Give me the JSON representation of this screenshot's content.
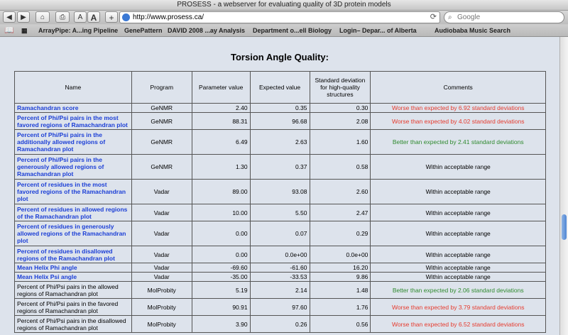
{
  "window": {
    "title": "PROSESS - a webserver for evaluating quality of 3D protein models"
  },
  "toolbar": {
    "back": "◀",
    "forward": "▶",
    "home": "⌂",
    "print": "⎙",
    "text_small": "A",
    "text_large": "A",
    "add_bookmark": "+",
    "url": "http://www.prosess.ca/",
    "reload": "⟳",
    "search_placeholder": "Google"
  },
  "bookmarks": [
    "ArrayPipe: A...ing Pipeline",
    "GenePattern",
    "DAVID 2008 ...ay Analysis",
    "Department o...ell Biology",
    "Login– Depar... of Alberta",
    "Audiobaba Music Search"
  ],
  "page": {
    "heading": "Torsion Angle Quality:",
    "columns": [
      "Name",
      "Program",
      "Parameter value",
      "Expected value",
      "Standard deviation for high-quality structures",
      "Comments"
    ],
    "rows": [
      {
        "name": "Ramachandran score",
        "link": true,
        "program": "GeNMR",
        "param": "2.40",
        "expected": "0.35",
        "sd": "0.30",
        "comment": "Worse than expected by 6.92 standard deviations",
        "status": "bad"
      },
      {
        "name": "Percent of Phi/Psi pairs in the most favored regions of Ramachandran plot",
        "link": true,
        "program": "GeNMR",
        "param": "88.31",
        "expected": "96.68",
        "sd": "2.08",
        "comment": "Worse than expected by 4.02 standard deviations",
        "status": "bad"
      },
      {
        "name": "Percent of Phi/Psi pairs in the additionally allowed regions of Ramachandran plot",
        "link": true,
        "program": "GeNMR",
        "param": "6.49",
        "expected": "2.63",
        "sd": "1.60",
        "comment": "Better than expected by 2.41 standard deviations",
        "status": "good"
      },
      {
        "name": "Percent of Phi/Psi pairs in the generously allowed regions of Ramachandran plot",
        "link": true,
        "program": "GeNMR",
        "param": "1.30",
        "expected": "0.37",
        "sd": "0.58",
        "comment": "Within acceptable range",
        "status": "ok"
      },
      {
        "name": "Percent of residues in the most favored regions of the Ramachandran plot",
        "link": true,
        "program": "Vadar",
        "param": "89.00",
        "expected": "93.08",
        "sd": "2.60",
        "comment": "Within acceptable range",
        "status": "ok"
      },
      {
        "name": "Percent of residues in allowed regions of the Ramachandran plot",
        "link": true,
        "program": "Vadar",
        "param": "10.00",
        "expected": "5.50",
        "sd": "2.47",
        "comment": "Within acceptable range",
        "status": "ok"
      },
      {
        "name": "Percent of residues in generously allowed regions of the Ramachandran plot",
        "link": true,
        "program": "Vadar",
        "param": "0.00",
        "expected": "0.07",
        "sd": "0.29",
        "comment": "Within acceptable range",
        "status": "ok"
      },
      {
        "name": "Percent of residues in disallowed regions of the Ramachandran plot",
        "link": true,
        "program": "Vadar",
        "param": "0.00",
        "expected": "0.0e+00",
        "sd": "0.0e+00",
        "comment": "Within acceptable range",
        "status": "ok"
      },
      {
        "name": "Mean Helix Phi angle",
        "link": true,
        "program": "Vadar",
        "param": "-69.60",
        "expected": "-61.60",
        "sd": "16.20",
        "comment": "Within acceptable range",
        "status": "ok"
      },
      {
        "name": "Mean Helix Psi angle",
        "link": true,
        "program": "Vadar",
        "param": "-35.00",
        "expected": "-33.53",
        "sd": "9.86",
        "comment": "Within acceptable range",
        "status": "ok"
      },
      {
        "name": "Percent of Phi/Psi pairs in the allowed regions of Ramachandran plot",
        "link": false,
        "program": "MolProbity",
        "param": "5.19",
        "expected": "2.14",
        "sd": "1.48",
        "comment": "Better than expected by 2.06 standard deviations",
        "status": "good"
      },
      {
        "name": "Percent of Phi/Psi pairs in the favored regions of Ramachandran plot",
        "link": false,
        "program": "MolProbity",
        "param": "90.91",
        "expected": "97.60",
        "sd": "1.76",
        "comment": "Worse than expected by 3.79 standard deviations",
        "status": "bad"
      },
      {
        "name": "Percent of Phi/Psi pairs in the disallowed regions of Ramachandran plot",
        "link": false,
        "program": "MolProbity",
        "param": "3.90",
        "expected": "0.26",
        "sd": "0.56",
        "comment": "Worse than expected by 6.52 standard deviations",
        "status": "bad"
      }
    ]
  },
  "colors": {
    "link": "#1c3fd6",
    "bad": "#e63b2e",
    "good": "#2f8a2f",
    "page_bg": "#dde3ec"
  }
}
